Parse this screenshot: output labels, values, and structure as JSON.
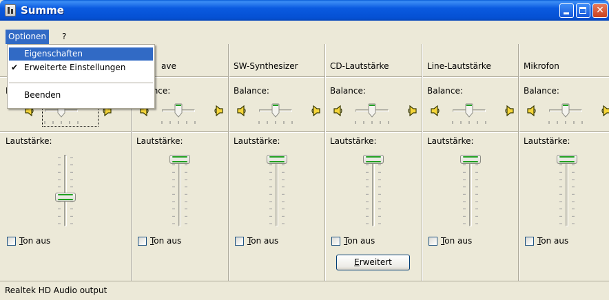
{
  "window": {
    "title": "Summe"
  },
  "titlebar_buttons": {
    "minimize_icon": "minimize-icon",
    "maximize_icon": "maximize-icon",
    "close_icon": "close-icon"
  },
  "menubar": {
    "items": [
      {
        "label": "Optionen"
      },
      {
        "label": "?"
      }
    ]
  },
  "dropdown": {
    "items": [
      {
        "label": "Eigenschaften",
        "highlighted": true
      },
      {
        "label": "Erweiterte Einstellungen",
        "checked": true
      },
      {
        "label": "Beenden"
      }
    ]
  },
  "channels": [
    {
      "name": "",
      "balance_label": "Balance:",
      "volume_label": "Lautstärke:",
      "mute_label": "Ton aus",
      "mute_accesskey": "T",
      "volume_level": 0.4
    },
    {
      "name": "ave",
      "balance_label": "lance:",
      "volume_label": "Lautstärke:",
      "mute_label": "Ton aus",
      "mute_accesskey": "T",
      "volume_level": 1.0
    },
    {
      "name": "SW-Synthesizer",
      "balance_label": "Balance:",
      "volume_label": "Lautstärke:",
      "mute_label": "Ton aus",
      "mute_accesskey": "T",
      "volume_level": 1.0
    },
    {
      "name": "CD-Lautstärke",
      "balance_label": "Balance:",
      "volume_label": "Lautstärke:",
      "mute_label": "Ton aus",
      "mute_accesskey": "T",
      "volume_level": 1.0,
      "advanced_button": "Erweitert",
      "advanced_accesskey": "E"
    },
    {
      "name": "Line-Lautstärke",
      "balance_label": "Balance:",
      "volume_label": "Lautstärke:",
      "mute_label": "Ton aus",
      "mute_accesskey": "T",
      "volume_level": 1.0
    },
    {
      "name": "Mikrofon",
      "balance_label": "Balance:",
      "volume_label": "Lautstärke:",
      "mute_label": "Ton aus",
      "mute_accesskey": "T",
      "volume_level": 1.0
    }
  ],
  "status": {
    "text": "Realtek HD Audio output"
  },
  "colors": {
    "titlebar": "#0a5ae0",
    "menu_highlight": "#316ac5",
    "face": "#ece9d8",
    "slider_green": "#21a121"
  }
}
